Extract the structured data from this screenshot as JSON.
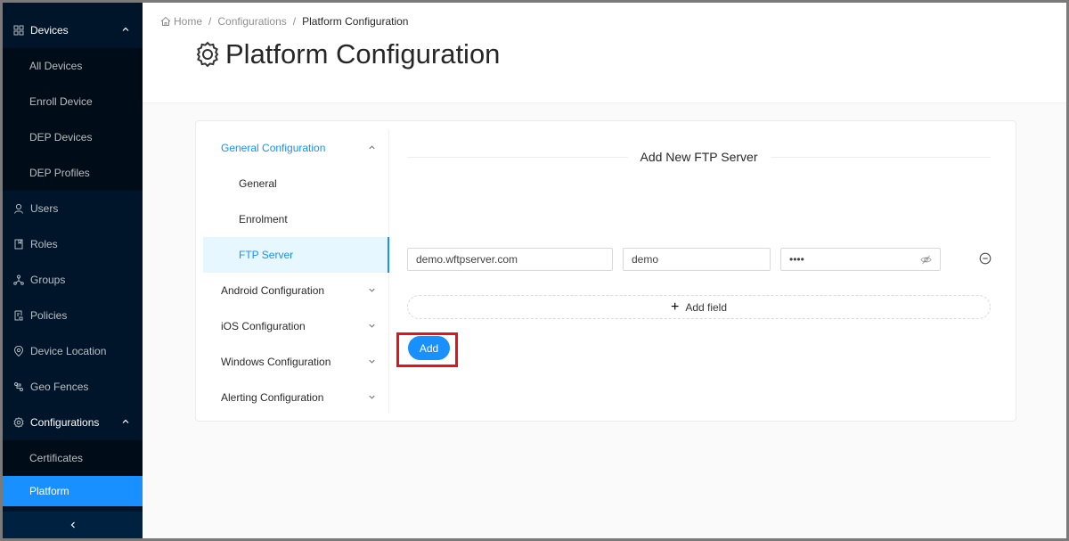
{
  "sidebar": {
    "items": [
      {
        "label": "Devices",
        "icon": "devices-grid-icon",
        "expanded": true,
        "children": [
          {
            "label": "All Devices"
          },
          {
            "label": "Enroll Device"
          },
          {
            "label": "DEP Devices"
          },
          {
            "label": "DEP Profiles"
          }
        ]
      },
      {
        "label": "Users",
        "icon": "user-icon"
      },
      {
        "label": "Roles",
        "icon": "book-icon"
      },
      {
        "label": "Groups",
        "icon": "cluster-icon"
      },
      {
        "label": "Policies",
        "icon": "file-protect-icon"
      },
      {
        "label": "Device Location",
        "icon": "location-icon"
      },
      {
        "label": "Geo Fences",
        "icon": "gateway-icon"
      },
      {
        "label": "Configurations",
        "icon": "setting-icon",
        "expanded": true,
        "children": [
          {
            "label": "Certificates"
          },
          {
            "label": "Platform",
            "active": true
          }
        ]
      }
    ],
    "collapse_icon": "<"
  },
  "breadcrumb": {
    "home": "Home",
    "items": [
      "Configurations",
      "Platform Configuration"
    ]
  },
  "page": {
    "title": "Platform Configuration"
  },
  "config_menu": {
    "group_title": "General Configuration",
    "group_items": [
      "General",
      "Enrolment",
      "FTP Server"
    ],
    "selected": "FTP Server",
    "other_groups": [
      "Android Configuration",
      "iOS Configuration",
      "Windows Configuration",
      "Alerting Configuration"
    ]
  },
  "ftp_form": {
    "section_title": "Add New FTP Server",
    "host_value": "demo.wftpserver.com",
    "username_value": "demo",
    "password_value": "demo",
    "add_field_label": "Add field",
    "submit_label": "Add"
  },
  "colors": {
    "sidebar_bg": "#001529",
    "accent": "#1890ff",
    "highlight": "#e0141e"
  }
}
